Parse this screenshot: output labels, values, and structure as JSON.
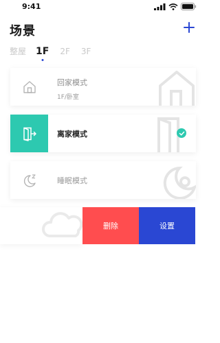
{
  "status_bar": {
    "time": "9:41"
  },
  "header": {
    "title": "场景"
  },
  "tabs": [
    {
      "label": "整屋"
    },
    {
      "label": "1F"
    },
    {
      "label": "2F"
    },
    {
      "label": "3F"
    }
  ],
  "active_tab": "1F",
  "scenes": [
    {
      "name": "回家模式",
      "room": "1F/卧室",
      "icon": "home-icon",
      "selected": false
    },
    {
      "name": "离家模式",
      "icon": "exit-door-icon",
      "selected": true
    },
    {
      "name": "睡眠模式",
      "icon": "moon-sleep-icon",
      "selected": false
    }
  ],
  "swipe_actions": {
    "delete": "删除",
    "settings": "设置"
  },
  "colors": {
    "accent": "#2a47d3",
    "selected": "#2dc9b0",
    "delete": "#ff4d4f"
  }
}
